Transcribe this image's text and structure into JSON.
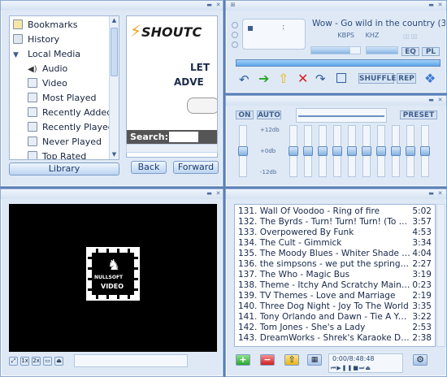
{
  "library": {
    "tree_items": [
      {
        "label": "Bookmarks",
        "icon": "bookmarks-icon"
      },
      {
        "label": "History",
        "icon": "history-icon"
      },
      {
        "label": "Local Media",
        "icon": "folder-expanded-icon"
      },
      {
        "label": "Audio",
        "icon": "speaker-icon"
      },
      {
        "label": "Video",
        "icon": "video-icon"
      },
      {
        "label": "Most Played",
        "icon": "query-icon"
      },
      {
        "label": "Recently Added",
        "icon": "query-icon"
      },
      {
        "label": "Recently Played",
        "icon": "query-icon"
      },
      {
        "label": "Never Played",
        "icon": "query-icon"
      },
      {
        "label": "Top Rated",
        "icon": "query-icon"
      }
    ],
    "library_button": "Library",
    "back_button": "Back",
    "forward_button": "Forward",
    "browser": {
      "logo": "SHOUTC",
      "headline1": "LET",
      "headline2": "ADVE",
      "search_label": "Search:"
    }
  },
  "player": {
    "song_title": "Wow - Go wild in the country (3:0",
    "kbps_label": "KBPS",
    "khz_label": "KHZ",
    "eq_toggle": "EQ",
    "pl_toggle": "PL",
    "shuffle": "SHUFFLE",
    "repeat": "REP",
    "position_fraction": 0.0,
    "volume_fraction": 0.8,
    "balance_fraction": 0.5
  },
  "equalizer": {
    "on_label": "ON",
    "auto_label": "AUTO",
    "preset_label": "PRESET",
    "scale_top": "+12db",
    "scale_mid": "+0db",
    "scale_bottom": "-12db",
    "preamp": 0.5,
    "bands": [
      0.5,
      0.5,
      0.5,
      0.5,
      0.5,
      0.5,
      0.5,
      0.5,
      0.5,
      0.5
    ]
  },
  "video": {
    "logo_line1": "NULLSOFT",
    "logo_line2": "VIDEO",
    "controls": [
      "fullscreen",
      "1x",
      "2x",
      "tv",
      "eject"
    ]
  },
  "playlist": {
    "items": [
      {
        "num": "131.",
        "title": "Wall Of Voodoo - Ring of fire",
        "dur": "5:02"
      },
      {
        "num": "132.",
        "title": "The Byrds - Turn! Turn! Turn! (To Ev...",
        "dur": "3:57"
      },
      {
        "num": "133.",
        "title": "Overpowered By Funk",
        "dur": "4:53"
      },
      {
        "num": "134.",
        "title": "The Cult - Gimmick",
        "dur": "3:34"
      },
      {
        "num": "135.",
        "title": "The Moody Blues - Whiter Shade of P...",
        "dur": "4:04"
      },
      {
        "num": "136.",
        "title": "the simpsons - we put the spring in s...",
        "dur": "2:27"
      },
      {
        "num": "137.",
        "title": "The Who - Magic Bus",
        "dur": "3:19"
      },
      {
        "num": "138.",
        "title": "Theme - Itchy And Scratchy Main Title",
        "dur": "0:23"
      },
      {
        "num": "139.",
        "title": "TV Themes - Love and Marriage",
        "dur": "2:19"
      },
      {
        "num": "140.",
        "title": "Three Dog Night - Joy To The World",
        "dur": "3:35"
      },
      {
        "num": "141.",
        "title": "Tony Orlando and Dawn - Tie A Yello...",
        "dur": "3:22"
      },
      {
        "num": "142.",
        "title": "Tom Jones - She's a Lady",
        "dur": "2:53"
      },
      {
        "num": "143.",
        "title": "DreamWorks - Shrek's Karaoke Danc...",
        "dur": "2:38"
      }
    ],
    "time_display": "0:00/8:48:48"
  },
  "colors": {
    "accent": "#6aa8e6",
    "frame": "#dfe9f5",
    "background": "#5a7fb8"
  }
}
